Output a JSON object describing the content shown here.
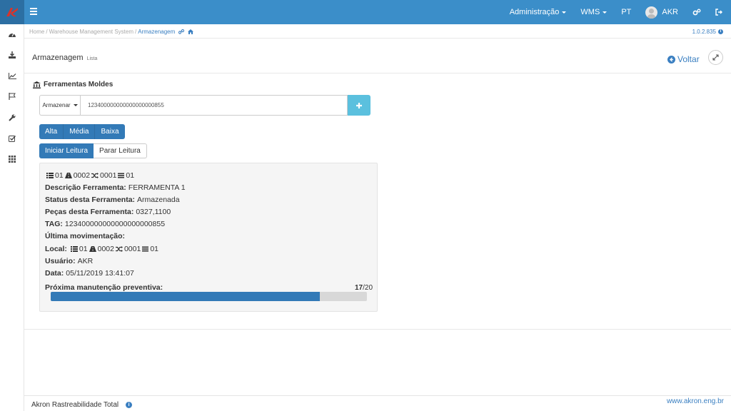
{
  "topbar": {
    "nav": [
      {
        "label": "Administração",
        "dropdown": true
      },
      {
        "label": "WMS",
        "dropdown": true
      },
      {
        "label": "PT",
        "dropdown": false
      }
    ],
    "user": "AKR",
    "icons": [
      "hamburger-icon",
      "cogs-icon",
      "sign-out-icon"
    ],
    "colors": {
      "bar": "#3b8ec9",
      "logo_bg": "#2c6fa3",
      "logo_mark": "#d9342b"
    }
  },
  "sidebar": {
    "icons": [
      "dashboard-icon",
      "download-icon",
      "chart-line-icon",
      "flag-icon",
      "wrench-icon",
      "check-square-icon",
      "grid-icon"
    ]
  },
  "breadcrumb": {
    "items": [
      "Home",
      "Warehouse Management System"
    ],
    "active": "Armazenagem",
    "version": "1.0.2.835"
  },
  "page": {
    "title": "Armazenagem",
    "subtitle": "Lista",
    "back_label": "Voltar"
  },
  "section": {
    "title": "Ferramentas Moldes"
  },
  "scan": {
    "mode": "Armazenar",
    "value": "123400000000000000000855"
  },
  "priority_buttons": [
    "Alta",
    "Média",
    "Baixa"
  ],
  "reading_buttons": {
    "start": "Iniciar Leitura",
    "stop": "Parar Leitura"
  },
  "tool": {
    "location": {
      "a": "01",
      "b": "0002",
      "c": "0001",
      "d": "01"
    },
    "description_label": "Descrição Ferramenta:",
    "description": "FERRAMENTA 1",
    "status_label": "Status desta Ferramenta:",
    "status": "Armazenada",
    "pieces_label": "Peças desta Ferramenta:",
    "pieces": "0327,1100",
    "tag_label": "TAG:",
    "tag": "123400000000000000000855",
    "last_move_label": "Última movimentação:",
    "local_label": "Local:",
    "last_location": {
      "a": "01",
      "b": "0002",
      "c": "0001",
      "d": "01"
    },
    "user_label": "Usuário:",
    "user": "AKR",
    "date_label": "Data:",
    "date": "05/11/2019 13:41:07",
    "maintenance_label": "Próxima manutenção preventiva:",
    "maintenance_done": "17",
    "maintenance_total": "/20",
    "maintenance_fraction": 0.85
  },
  "footer": {
    "left": "Akron Rastreabilidade Total",
    "right": "www.akron.eng.br"
  }
}
